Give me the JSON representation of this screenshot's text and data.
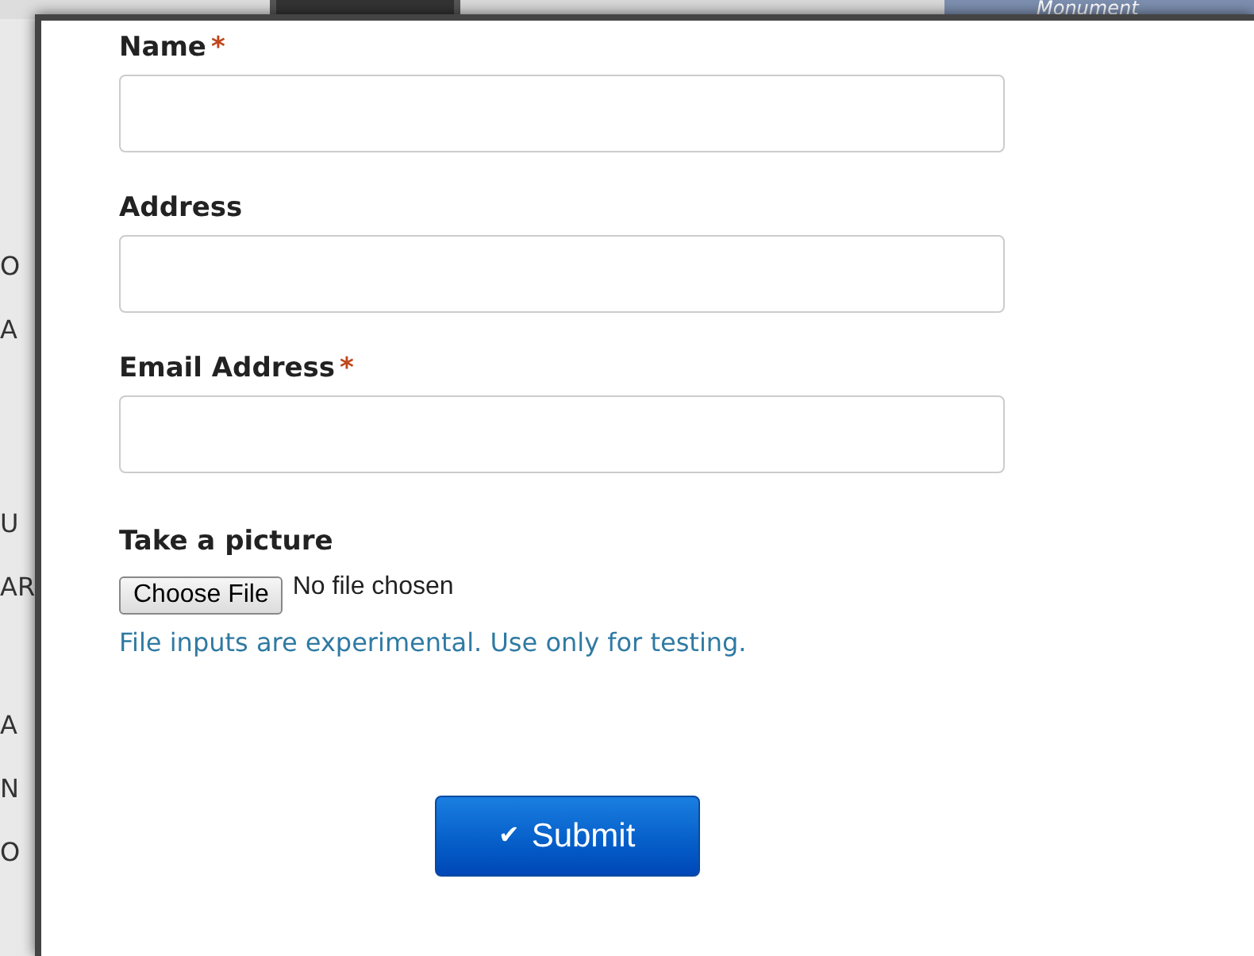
{
  "background": {
    "menu_item": "Monument",
    "side_texts": [
      "O",
      "A",
      "U",
      "AR",
      "A",
      "N",
      "O"
    ]
  },
  "form": {
    "fields": [
      {
        "kind": "text",
        "label": "Name",
        "marker": "*"
      },
      {
        "kind": "text",
        "label": "Address"
      },
      {
        "kind": "text",
        "label": "Email Address",
        "marker": "*"
      },
      {
        "kind": "file",
        "label": "Take a picture",
        "button": "Choose File",
        "status": "No file chosen",
        "help": "File inputs are experimental. Use only for testing."
      }
    ],
    "submit": {
      "icon": "✔",
      "label": "Submit"
    }
  }
}
